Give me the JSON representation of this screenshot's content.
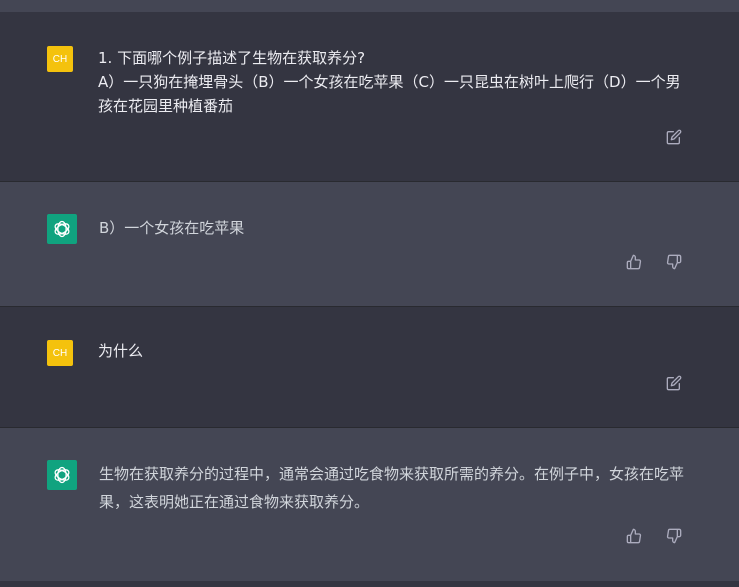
{
  "conversation": {
    "messages": [
      {
        "role": "user",
        "avatar_label": "CH",
        "text": "1. 下面哪个例子描述了生物在获取养分?\nA）一只狗在掩埋骨头（B）一个女孩在吃苹果（C）一只昆虫在树叶上爬行（D）一个男孩在花园里种植番茄",
        "action_icon": "edit-icon"
      },
      {
        "role": "assistant",
        "avatar_icon": "openai-logo-icon",
        "text": "B）一个女孩在吃苹果",
        "action_icons": [
          "thumbs-up-icon",
          "thumbs-down-icon"
        ]
      },
      {
        "role": "user",
        "avatar_label": "CH",
        "text": "为什么",
        "action_icon": "edit-icon"
      },
      {
        "role": "assistant",
        "avatar_icon": "openai-logo-icon",
        "text": "生物在获取养分的过程中，通常会通过吃食物来获取所需的养分。在例子中，女孩在吃苹果，这表明她正在通过食物来获取养分。",
        "action_icons": [
          "thumbs-up-icon",
          "thumbs-down-icon"
        ]
      }
    ]
  },
  "colors": {
    "user_bg": "#343541",
    "assistant_bg": "#444654",
    "user_avatar": "#f4c20d",
    "assistant_avatar": "#10a37f",
    "text": "#ececf1",
    "icon": "#acacbe"
  }
}
